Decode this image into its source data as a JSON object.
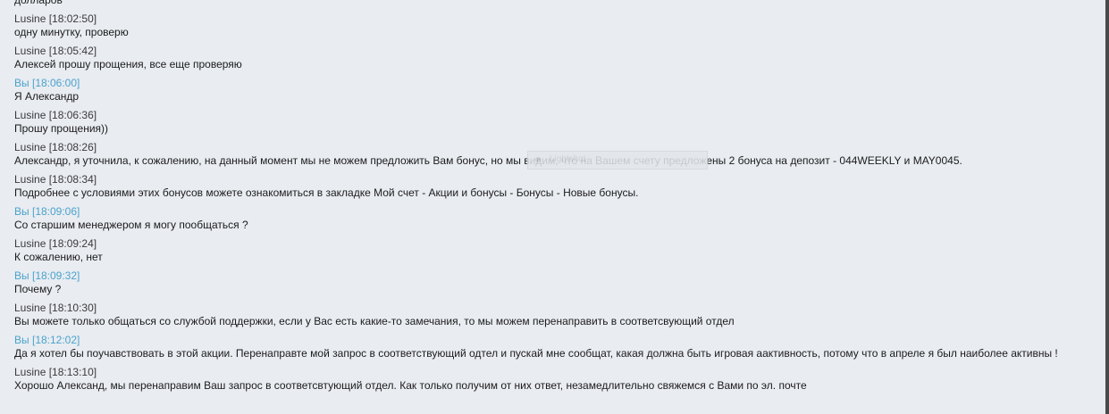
{
  "chat": {
    "messages": [
      {
        "sender": "",
        "time": "",
        "is_me": false,
        "text": "долларов"
      },
      {
        "sender": "Lusine",
        "time": "[18:02:50]",
        "is_me": false,
        "text": "одну минутку, проверю"
      },
      {
        "sender": "Lusine",
        "time": "[18:05:42]",
        "is_me": false,
        "text": "Алексей прошу прощения, все еще проверяю"
      },
      {
        "sender": "Вы",
        "time": "[18:06:00]",
        "is_me": true,
        "text": "Я Александр"
      },
      {
        "sender": "Lusine",
        "time": "[18:06:36]",
        "is_me": false,
        "text": "Прошу прощения))"
      },
      {
        "sender": "Lusine",
        "time": "[18:08:26]",
        "is_me": false,
        "text": "Александр, я уточнила, к сожалению, на данный момент мы не можем предложить Вам бонус, но мы видим, что на Вашем счету предложены 2 бонуса на депозит - 044WEEKLY и MAY0045."
      },
      {
        "sender": "Lusine",
        "time": "[18:08:34]",
        "is_me": false,
        "text": "Подробнее с условиями этих бонусов можете ознакомиться в закладке Мой счет - Акции и бонусы - Бонусы - Новые бонусы."
      },
      {
        "sender": "Вы",
        "time": "[18:09:06]",
        "is_me": true,
        "text": "Со старшим менеджером я могу пообщаться ?"
      },
      {
        "sender": "Lusine",
        "time": "[18:09:24]",
        "is_me": false,
        "text": "К сожалению, нет"
      },
      {
        "sender": "Вы",
        "time": "[18:09:32]",
        "is_me": true,
        "text": "Почему ?"
      },
      {
        "sender": "Lusine",
        "time": "[18:10:30]",
        "is_me": false,
        "text": "Вы можете только общаться со службой поддержки, если у Вас есть какие-то замечания, то мы можем перенаправить в соответсвующий отдел"
      },
      {
        "sender": "Вы",
        "time": "[18:12:02]",
        "is_me": true,
        "text": "Да я хотел бы поучавствовать в этой акции. Перенаправте мой запрос в соответствующий одтел и пускай мне сообщат, какая должна быть игровая аактивность, потому что в апреле я был наиболее активны !"
      },
      {
        "sender": "Lusine",
        "time": "[18:13:10]",
        "is_me": false,
        "text": "Хорошо Александ, мы перенаправим Ваш запрос в соответсвтующий отдел. Как только получим от них ответ, незамедлительно свяжемся с Вами по эл. почте"
      }
    ]
  },
  "overlay": {
    "label": "Lightshot"
  },
  "colors": {
    "background": "#e9ecf1",
    "me": "#4aa3cc",
    "other": "#3a3a3a",
    "text": "#1b1b1b"
  }
}
